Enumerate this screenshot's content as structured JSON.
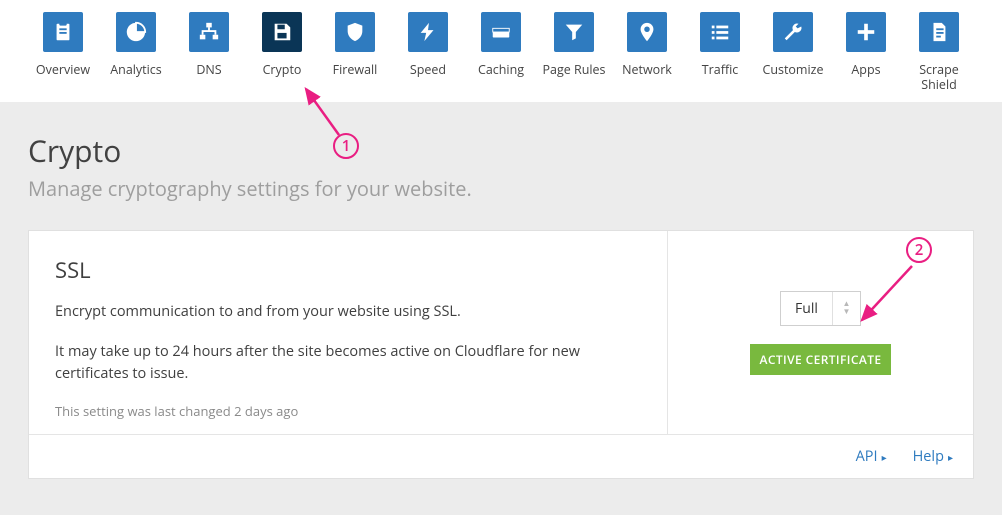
{
  "nav": [
    {
      "id": "overview",
      "label": "Overview",
      "icon": "clipboard"
    },
    {
      "id": "analytics",
      "label": "Analytics",
      "icon": "pie"
    },
    {
      "id": "dns",
      "label": "DNS",
      "icon": "sitemap"
    },
    {
      "id": "crypto",
      "label": "Crypto",
      "icon": "save",
      "active": true
    },
    {
      "id": "firewall",
      "label": "Firewall",
      "icon": "shield"
    },
    {
      "id": "speed",
      "label": "Speed",
      "icon": "bolt"
    },
    {
      "id": "caching",
      "label": "Caching",
      "icon": "drive"
    },
    {
      "id": "pagerules",
      "label": "Page Rules",
      "icon": "funnel"
    },
    {
      "id": "network",
      "label": "Network",
      "icon": "pin"
    },
    {
      "id": "traffic",
      "label": "Traffic",
      "icon": "list"
    },
    {
      "id": "customize",
      "label": "Customize",
      "icon": "wrench"
    },
    {
      "id": "apps",
      "label": "Apps",
      "icon": "plus"
    },
    {
      "id": "scrape",
      "label": "Scrape Shield",
      "icon": "doc"
    }
  ],
  "page": {
    "title": "Crypto",
    "subtitle": "Manage cryptography settings for your website."
  },
  "card": {
    "title": "SSL",
    "p1": "Encrypt communication to and from your website using SSL.",
    "p2": "It may take up to 24 hours after the site becomes active on Cloudflare for new certificates to issue.",
    "meta": "This setting was last changed 2 days ago",
    "select_value": "Full",
    "badge": "ACTIVE CERTIFICATE"
  },
  "footer": {
    "api": "API",
    "help": "Help"
  },
  "annotations": {
    "a1": "1",
    "a2": "2"
  }
}
